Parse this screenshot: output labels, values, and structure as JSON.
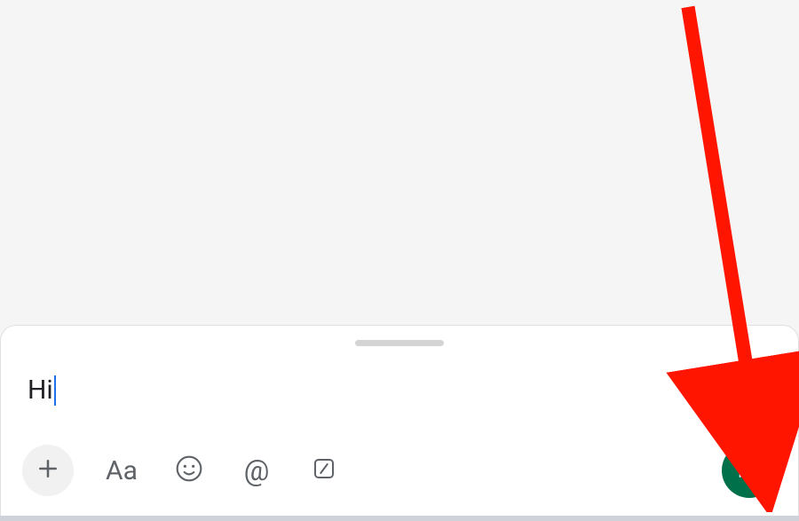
{
  "compose": {
    "message_text": "Hi"
  },
  "toolbar": {
    "format_label": "Aa",
    "mention_label": "@"
  },
  "colors": {
    "send_button_bg": "#00704b",
    "annotation_arrow": "#ff1500"
  }
}
